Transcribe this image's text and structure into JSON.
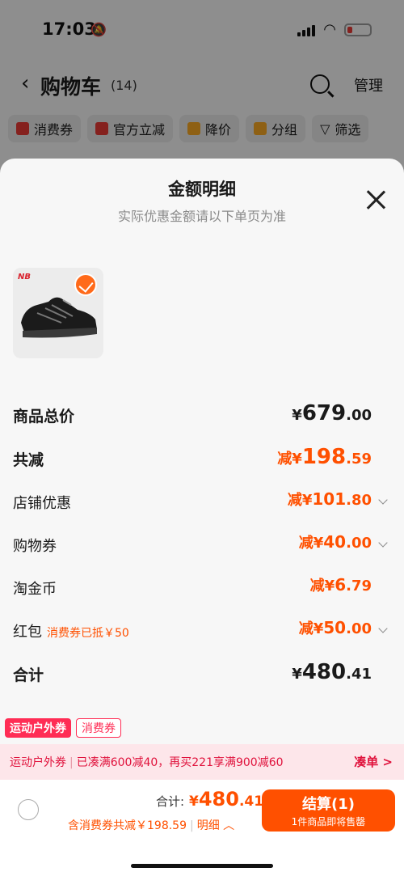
{
  "status_bar": {
    "time": "17:03"
  },
  "cart_header": {
    "title": "购物车",
    "count": "(14)",
    "manage_label": "管理"
  },
  "chips": [
    {
      "label": "消费券",
      "icon": "coupon-icon",
      "color": "#e53935"
    },
    {
      "label": "官方立减",
      "icon": "bolt-icon",
      "color": "#e53935"
    },
    {
      "label": "降价",
      "icon": "down-arrow-icon",
      "color": "#f5a623"
    },
    {
      "label": "分组",
      "icon": "folder-icon",
      "color": "#f5a623"
    },
    {
      "label": "筛选",
      "icon": "filter-icon",
      "color": "#333333"
    }
  ],
  "sheet": {
    "title": "金额明细",
    "subtitle": "实际优惠金额请以下单页为准",
    "product_brand": "NB"
  },
  "rows": {
    "goods_total": {
      "label": "商品总价",
      "currency": "¥",
      "int": "679",
      "dec": ".00"
    },
    "total_reduce": {
      "label": "共减",
      "prefix": "减¥",
      "int": "198",
      "dec": ".59"
    },
    "shop_discount": {
      "label": "店铺优惠",
      "prefix": "减¥",
      "int": "101",
      "dec": ".80"
    },
    "shopping_coupon": {
      "label": "购物券",
      "prefix": "减¥",
      "int": "40",
      "dec": ".00"
    },
    "taojinbi": {
      "label": "淘金币",
      "prefix": "减¥",
      "int": "6",
      "dec": ".79"
    },
    "red_packet": {
      "label": "红包",
      "tag": "消费券已抵￥50",
      "prefix": "减¥",
      "int": "50",
      "dec": ".00"
    },
    "subtotal": {
      "label": "合计",
      "currency": "¥",
      "int": "480",
      "dec": ".41"
    }
  },
  "promo_tags": {
    "tag1": "运动户外券",
    "tag2": "消费券"
  },
  "promo_bar": {
    "part1": "运动户外券",
    "part2": "已凑满600减40，再买221享满900减60",
    "action": "凑单 >"
  },
  "bottom_bar": {
    "total_label": "合计:",
    "total_currency": "¥",
    "total_int": "480",
    "total_dec": ".41",
    "discount_text": "含消费券共减￥198.59",
    "detail_label": "明细",
    "pay_label": "结算(1)",
    "pay_sub": "1件商品即将售罄"
  },
  "colors": {
    "accent": "#ff5000",
    "promo_red": "#ff2d55"
  }
}
